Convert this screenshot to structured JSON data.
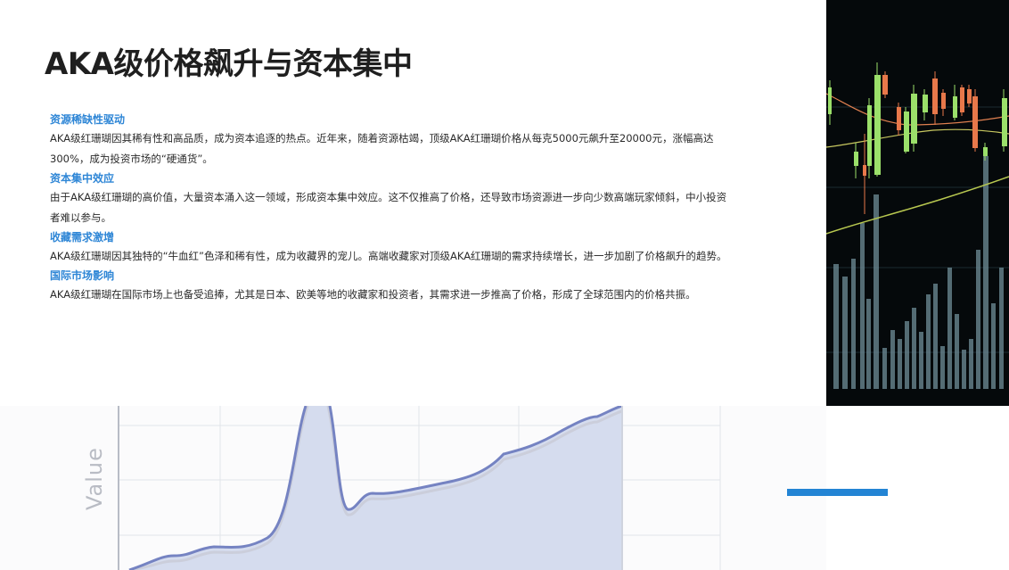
{
  "slide": {
    "title": "AKA级价格飙升与资本集中",
    "sections": [
      {
        "heading": "资源稀缺性驱动",
        "body": "AKA级红珊瑚因其稀有性和高品质，成为资本追逐的热点。近年来，随着资源枯竭，顶级AKA红珊瑚价格从每克5000元飙升至20000元，涨幅高达300%，成为投资市场的“硬通货”。"
      },
      {
        "heading": "资本集中效应",
        "body": "由于AKA级红珊瑚的高价值，大量资本涌入这一领域，形成资本集中效应。这不仅推高了价格，还导致市场资源进一步向少数高端玩家倾斜，中小投资者难以参与。"
      },
      {
        "heading": "收藏需求激增",
        "body": "AKA级红珊瑚因其独特的“牛血红”色泽和稀有性，成为收藏界的宠儿。高端收藏家对顶级AKA红珊瑚的需求持续增长，进一步加剧了价格飙升的趋势。"
      },
      {
        "heading": "国际市场影响",
        "body": "AKA级红珊瑚在国际市场上也备受追捧，尤其是日本、欧美等地的收藏家和投资者，其需求进一步推高了价格，形成了全球范围内的价格共振。"
      }
    ]
  },
  "decor_chart": {
    "axis_label": "Value",
    "line_color": "#7583c2",
    "fill_color": "#d5dcee"
  },
  "stock_image": {
    "icon": "candlestick-chart-photo"
  },
  "colors": {
    "heading": "#2e86d6",
    "accent": "#2384d4",
    "title": "#1f1f1f"
  }
}
